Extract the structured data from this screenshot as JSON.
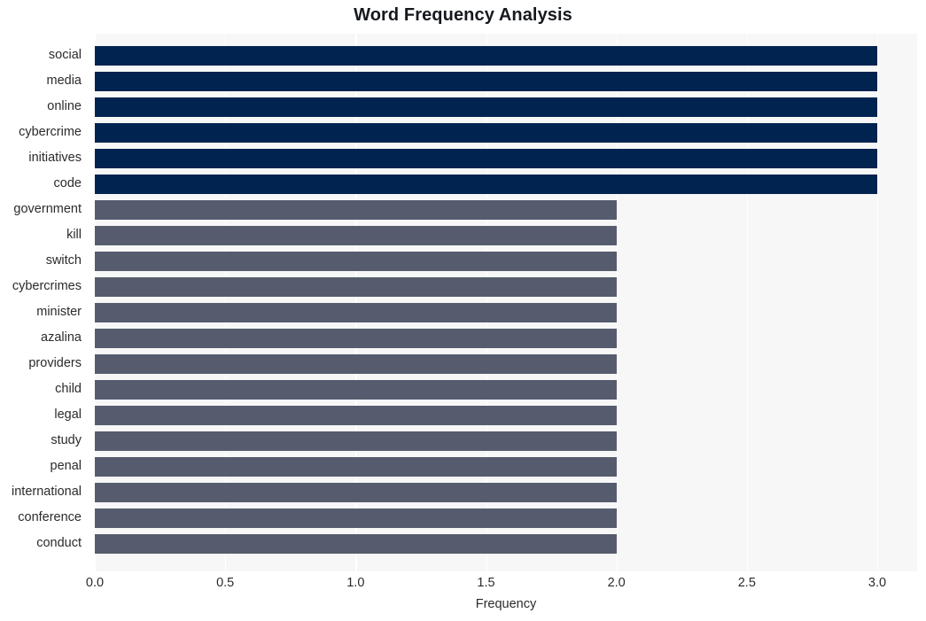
{
  "chart_data": {
    "type": "bar",
    "orientation": "horizontal",
    "title": "Word Frequency Analysis",
    "xlabel": "Frequency",
    "ylabel": "",
    "xlim": [
      0.0,
      3.0
    ],
    "xticks": [
      "0.0",
      "0.5",
      "1.0",
      "1.5",
      "2.0",
      "2.5",
      "3.0"
    ],
    "xtick_values": [
      0.0,
      0.5,
      1.0,
      1.5,
      2.0,
      2.5,
      3.0
    ],
    "grid": true,
    "grid_axis": "x",
    "grid_color": "#ffffff",
    "plot_background": "#f7f7f7",
    "legend": null,
    "categories": [
      "social",
      "media",
      "online",
      "cybercrime",
      "initiatives",
      "code",
      "government",
      "kill",
      "switch",
      "cybercrimes",
      "minister",
      "azalina",
      "providers",
      "child",
      "legal",
      "study",
      "penal",
      "international",
      "conference",
      "conduct"
    ],
    "values": [
      3,
      3,
      3,
      3,
      3,
      3,
      2,
      2,
      2,
      2,
      2,
      2,
      2,
      2,
      2,
      2,
      2,
      2,
      2,
      2
    ],
    "bar_colors": [
      "#002350",
      "#002350",
      "#002350",
      "#002350",
      "#002350",
      "#002350",
      "#565c6e",
      "#565c6e",
      "#565c6e",
      "#565c6e",
      "#565c6e",
      "#565c6e",
      "#565c6e",
      "#565c6e",
      "#565c6e",
      "#565c6e",
      "#565c6e",
      "#565c6e",
      "#565c6e",
      "#565c6e"
    ],
    "palette": {
      "high": "#002350",
      "low": "#565c6e"
    }
  }
}
